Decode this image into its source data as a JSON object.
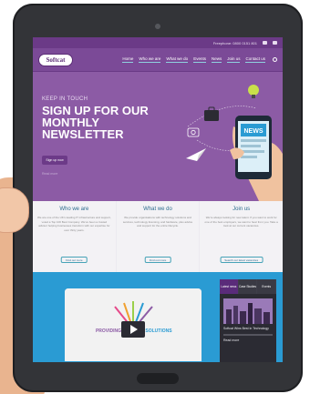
{
  "topbar": {
    "phone": "Freephone: 0800 0151 801"
  },
  "nav": {
    "logo": "Softcat",
    "items": [
      "Home",
      "Who we are",
      "What we do",
      "Events",
      "News",
      "Join us",
      "Contact us"
    ]
  },
  "hero": {
    "kicker": "KEEP IN TOUCH",
    "title": "SIGN UP FOR OUR MONTHLY NEWSLETTER",
    "button": "Sign up now",
    "note": "Read more",
    "phone_label": "NEWS"
  },
  "cards": [
    {
      "title": "Who we are",
      "text": "We are one of the UK's leading IT infrastructure and support, voted a Top 100 Best Company. We've been a trusted advisor helping businesses transform with our expertise for over thirty years.",
      "button": "Find out more"
    },
    {
      "title": "What we do",
      "text": "We provide organisations with technology solutions and services, technology licensing, and hardware, plus advice and support for the entire lifecycle.",
      "button": "Find out more"
    },
    {
      "title": "Join us",
      "text": "We're always looking for new talent. If you want to work for one of the best employers, we want to hear from you. Take a look at our current vacancies.",
      "button": "Search our latest vacancies"
    }
  ],
  "video": {
    "left_label": "PROVIDING",
    "right_label": "SOLUTIONS"
  },
  "sidebar": {
    "tabs": [
      "Latest news",
      "Case Studies",
      "Events"
    ],
    "headline": "Softcat Wins Best in Technology",
    "line": "Read more"
  },
  "colors": {
    "purple": "#8c5ba5",
    "dark_purple": "#6b3a87",
    "blue": "#2a9bd3",
    "tablet": "#333438"
  }
}
